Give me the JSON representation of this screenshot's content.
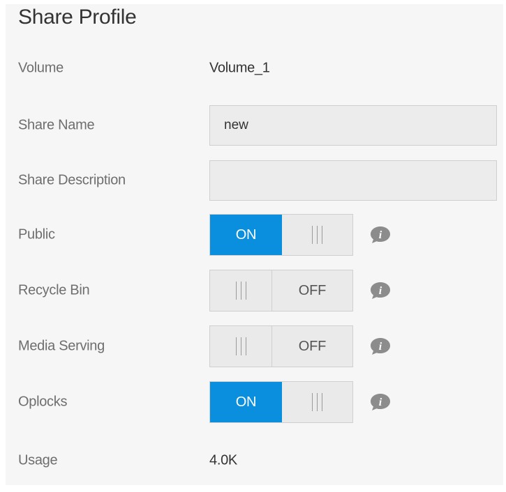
{
  "title": "Share Profile",
  "volume": {
    "label": "Volume",
    "value": "Volume_1"
  },
  "share_name": {
    "label": "Share Name",
    "value": "new"
  },
  "share_description": {
    "label": "Share Description",
    "value": ""
  },
  "public": {
    "label": "Public",
    "state": "ON",
    "on_label": "ON"
  },
  "recycle_bin": {
    "label": "Recycle Bin",
    "state": "OFF",
    "off_label": "OFF"
  },
  "media_serving": {
    "label": "Media Serving",
    "state": "OFF",
    "off_label": "OFF"
  },
  "oplocks": {
    "label": "Oplocks",
    "state": "ON",
    "on_label": "ON"
  },
  "usage": {
    "label": "Usage",
    "value": "4.0K"
  },
  "colors": {
    "accent": "#0a8fdf",
    "panel": "#f6f6f6",
    "label": "#6e6e6e"
  },
  "icons": {
    "info": "info-icon",
    "grip": "grip-icon"
  }
}
